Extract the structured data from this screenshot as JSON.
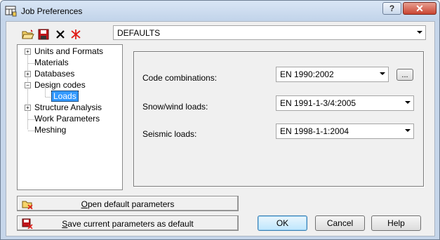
{
  "window": {
    "title": "Job Preferences",
    "help_glyph": "?",
    "close_glyph": "✕"
  },
  "toolbar": {
    "icons": [
      "open-folder-icon",
      "save-icon",
      "delete-icon",
      "reset-icon"
    ],
    "preset_value": "DEFAULTS"
  },
  "tree": {
    "items": [
      {
        "label": "Units and Formats",
        "expander": "+"
      },
      {
        "label": "Materials"
      },
      {
        "label": "Databases",
        "expander": "+"
      },
      {
        "label": "Design codes",
        "expander": "−"
      },
      {
        "label": "Loads",
        "selected": true
      },
      {
        "label": "Structure Analysis",
        "expander": "+"
      },
      {
        "label": "Work Parameters"
      },
      {
        "label": "Meshing"
      }
    ]
  },
  "form": {
    "code_combinations_label": "Code combinations:",
    "code_combinations_value": "EN 1990:2002",
    "browse_label": "...",
    "snow_wind_label": "Snow/wind loads:",
    "snow_wind_value": "EN 1991-1-3/4:2005",
    "seismic_label": "Seismic loads:",
    "seismic_value": "EN 1998-1-1:2004"
  },
  "bottom": {
    "open_default_prefix": "O",
    "open_default_rest": "pen default parameters",
    "save_default_prefix": "S",
    "save_default_rest": "ave current parameters as default",
    "ok_label": "OK",
    "cancel_label": "Cancel",
    "help_label": "Help"
  },
  "colors": {
    "selection": "#3399ff",
    "close_button": "#c94431",
    "title_bar": "#c2d4ea"
  }
}
